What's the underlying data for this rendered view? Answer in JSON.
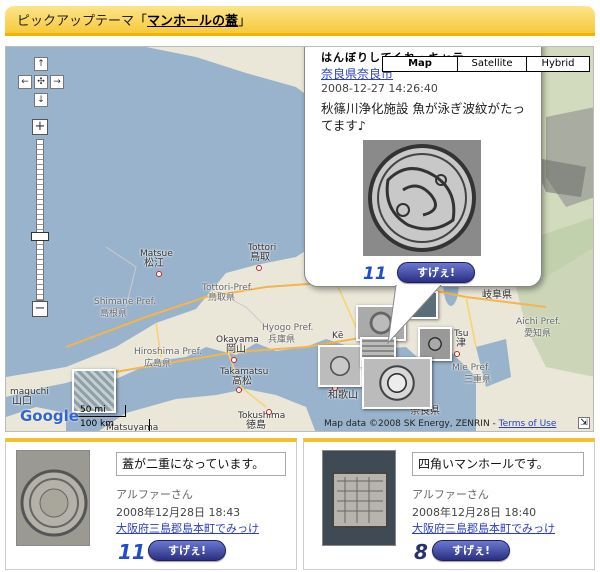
{
  "header": {
    "prefix": "ピックアップテーマ",
    "open_bracket": "「",
    "theme_link": "マンホールの蓋",
    "close_bracket": "」"
  },
  "map": {
    "type_buttons": [
      "Map",
      "Satellite",
      "Hybrid"
    ],
    "active_type": "Map",
    "labels": {
      "matsue": "Matsue",
      "matsue_jp": "松江",
      "tottori": "Tottori",
      "tottori_jp": "鳥取",
      "tottori_pref": "Tottori-Pref.",
      "tottori_pref_jp": "鳥取県",
      "shimane_pref": "Shimane Pref.",
      "shimane_jp": "島根県",
      "hiroshima_pref": "Hiroshima Pref.",
      "hiroshima_jp": "広島県",
      "okayama": "Okayama",
      "okayama_jp": "岡山",
      "hyogo_pref": "Hyogo Pref.",
      "hyogo_jp": "兵庫県",
      "takamatsu": "Takamatsu",
      "takamatsu_jp": "高松",
      "tokushima": "Tokushima",
      "tokushima_jp": "徳島",
      "mie_pref": "Mie Pref.",
      "mie_jp": "三重県",
      "aichi_pref": "Aichi Pref.",
      "aichi_jp": "愛知県",
      "tsu": "Tsu",
      "tsu_jp": "津",
      "nara_jp": "奈良県",
      "wakayama_jp": "和歌山",
      "yamaguchi": "maguchi",
      "yamaguchi_jp": "山口",
      "matsuyama": "Matsuyama",
      "ki": "Kē",
      "gifu_jp": "岐阜県"
    },
    "scale_mi": "50 mi",
    "scale_km": "100 km",
    "copyright": "Map data ©2008 SK Energy, ZENRIN -",
    "terms": "Terms of Use",
    "google": "Google"
  },
  "infowindow": {
    "cut_text": "はんぼりしてくれ・キャテ",
    "location": "奈良県奈良市",
    "timestamp": "2008-12-27 14:26:40",
    "message": "秋篠川浄化施設 魚が泳ぎ波紋がたってます♪",
    "count": "11",
    "button": "すげぇ!"
  },
  "cards": [
    {
      "comment": "蓋が二重になっています。",
      "user": "アルファーさん",
      "date": "2008年12月28日 18:43",
      "place": "大阪府三島郡島本町でみっけ",
      "count": "11",
      "button": "すげぇ!"
    },
    {
      "comment": "四角いマンホールです。",
      "user": "アルファーさん",
      "date": "2008年12月28日 18:40",
      "place": "大阪府三島郡島本町でみっけ",
      "count": "8",
      "button": "すげぇ!"
    }
  ],
  "colors": {
    "header_bg": "#f7c93d",
    "link": "#2a3fbf",
    "count_blue": "#1e4ec8",
    "count_navy": "#2a2f6e",
    "button": "#2b2f83"
  }
}
